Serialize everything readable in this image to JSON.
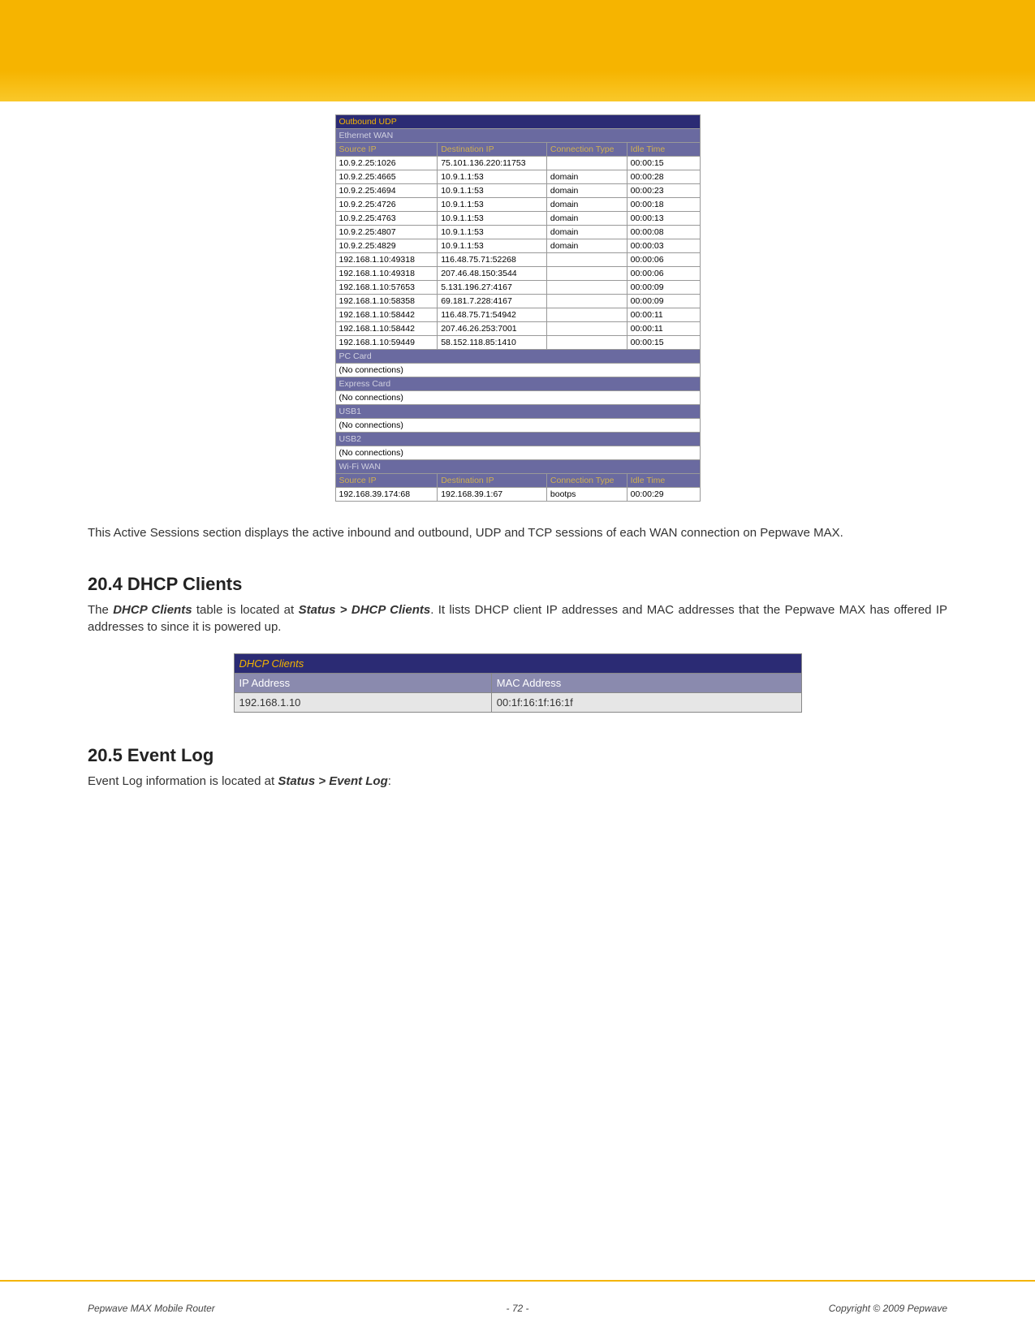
{
  "header": {
    "gold_bar": true
  },
  "sessions": {
    "title": "Outbound UDP",
    "headers": [
      "Source IP",
      "Destination IP",
      "Connection Type",
      "Idle Time"
    ],
    "groups": [
      {
        "name": "Ethernet WAN",
        "rows": [
          {
            "src": "10.9.2.25:1026",
            "dst": "75.101.136.220:11753",
            "type": "",
            "idle": "00:00:15"
          },
          {
            "src": "10.9.2.25:4665",
            "dst": "10.9.1.1:53",
            "type": "domain",
            "idle": "00:00:28"
          },
          {
            "src": "10.9.2.25:4694",
            "dst": "10.9.1.1:53",
            "type": "domain",
            "idle": "00:00:23"
          },
          {
            "src": "10.9.2.25:4726",
            "dst": "10.9.1.1:53",
            "type": "domain",
            "idle": "00:00:18"
          },
          {
            "src": "10.9.2.25:4763",
            "dst": "10.9.1.1:53",
            "type": "domain",
            "idle": "00:00:13"
          },
          {
            "src": "10.9.2.25:4807",
            "dst": "10.9.1.1:53",
            "type": "domain",
            "idle": "00:00:08"
          },
          {
            "src": "10.9.2.25:4829",
            "dst": "10.9.1.1:53",
            "type": "domain",
            "idle": "00:00:03"
          },
          {
            "src": "192.168.1.10:49318",
            "dst": "116.48.75.71:52268",
            "type": "",
            "idle": "00:00:06"
          },
          {
            "src": "192.168.1.10:49318",
            "dst": "207.46.48.150:3544",
            "type": "",
            "idle": "00:00:06"
          },
          {
            "src": "192.168.1.10:57653",
            "dst": "5.131.196.27:4167",
            "type": "",
            "idle": "00:00:09"
          },
          {
            "src": "192.168.1.10:58358",
            "dst": "69.181.7.228:4167",
            "type": "",
            "idle": "00:00:09"
          },
          {
            "src": "192.168.1.10:58442",
            "dst": "116.48.75.71:54942",
            "type": "",
            "idle": "00:00:11"
          },
          {
            "src": "192.168.1.10:58442",
            "dst": "207.46.26.253:7001",
            "type": "",
            "idle": "00:00:11"
          },
          {
            "src": "192.168.1.10:59449",
            "dst": "58.152.118.85:1410",
            "type": "",
            "idle": "00:00:15"
          }
        ]
      },
      {
        "name": "PC Card",
        "empty": "(No connections)"
      },
      {
        "name": "Express Card",
        "empty": "(No connections)"
      },
      {
        "name": "USB1",
        "empty": "(No connections)"
      },
      {
        "name": "USB2",
        "empty": "(No connections)"
      },
      {
        "name": "Wi-Fi WAN",
        "rows": [
          {
            "src": "192.168.39.174:68",
            "dst": "192.168.39.1:67",
            "type": "bootps",
            "idle": "00:00:29"
          }
        ]
      }
    ]
  },
  "paragraphs": {
    "p1": "This Active Sessions section displays the active inbound and outbound, UDP and TCP sessions of each WAN connection on Pepwave MAX.",
    "h204": "20.4  DHCP Clients",
    "p2a": "The ",
    "p2b": "DHCP Clients",
    "p2c": " table is located at ",
    "p2d": "Status > DHCP Clients",
    "p2e": ".  It lists DHCP client IP addresses and MAC addresses that the Pepwave MAX has offered IP addresses to since it is powered up.",
    "h205": "20.5  Event Log",
    "p3a": "Event Log information is located at ",
    "p3b": "Status > Event Log",
    "p3c": ":"
  },
  "dhcp": {
    "title": "DHCP Clients",
    "headers": [
      "IP Address",
      "MAC Address"
    ],
    "rows": [
      {
        "ip": "192.168.1.10",
        "mac": "00:1f:16:1f:16:1f"
      }
    ]
  },
  "footer": {
    "left": "Pepwave MAX Mobile Router",
    "center": "- 72 -",
    "right": "Copyright © 2009 Pepwave"
  }
}
